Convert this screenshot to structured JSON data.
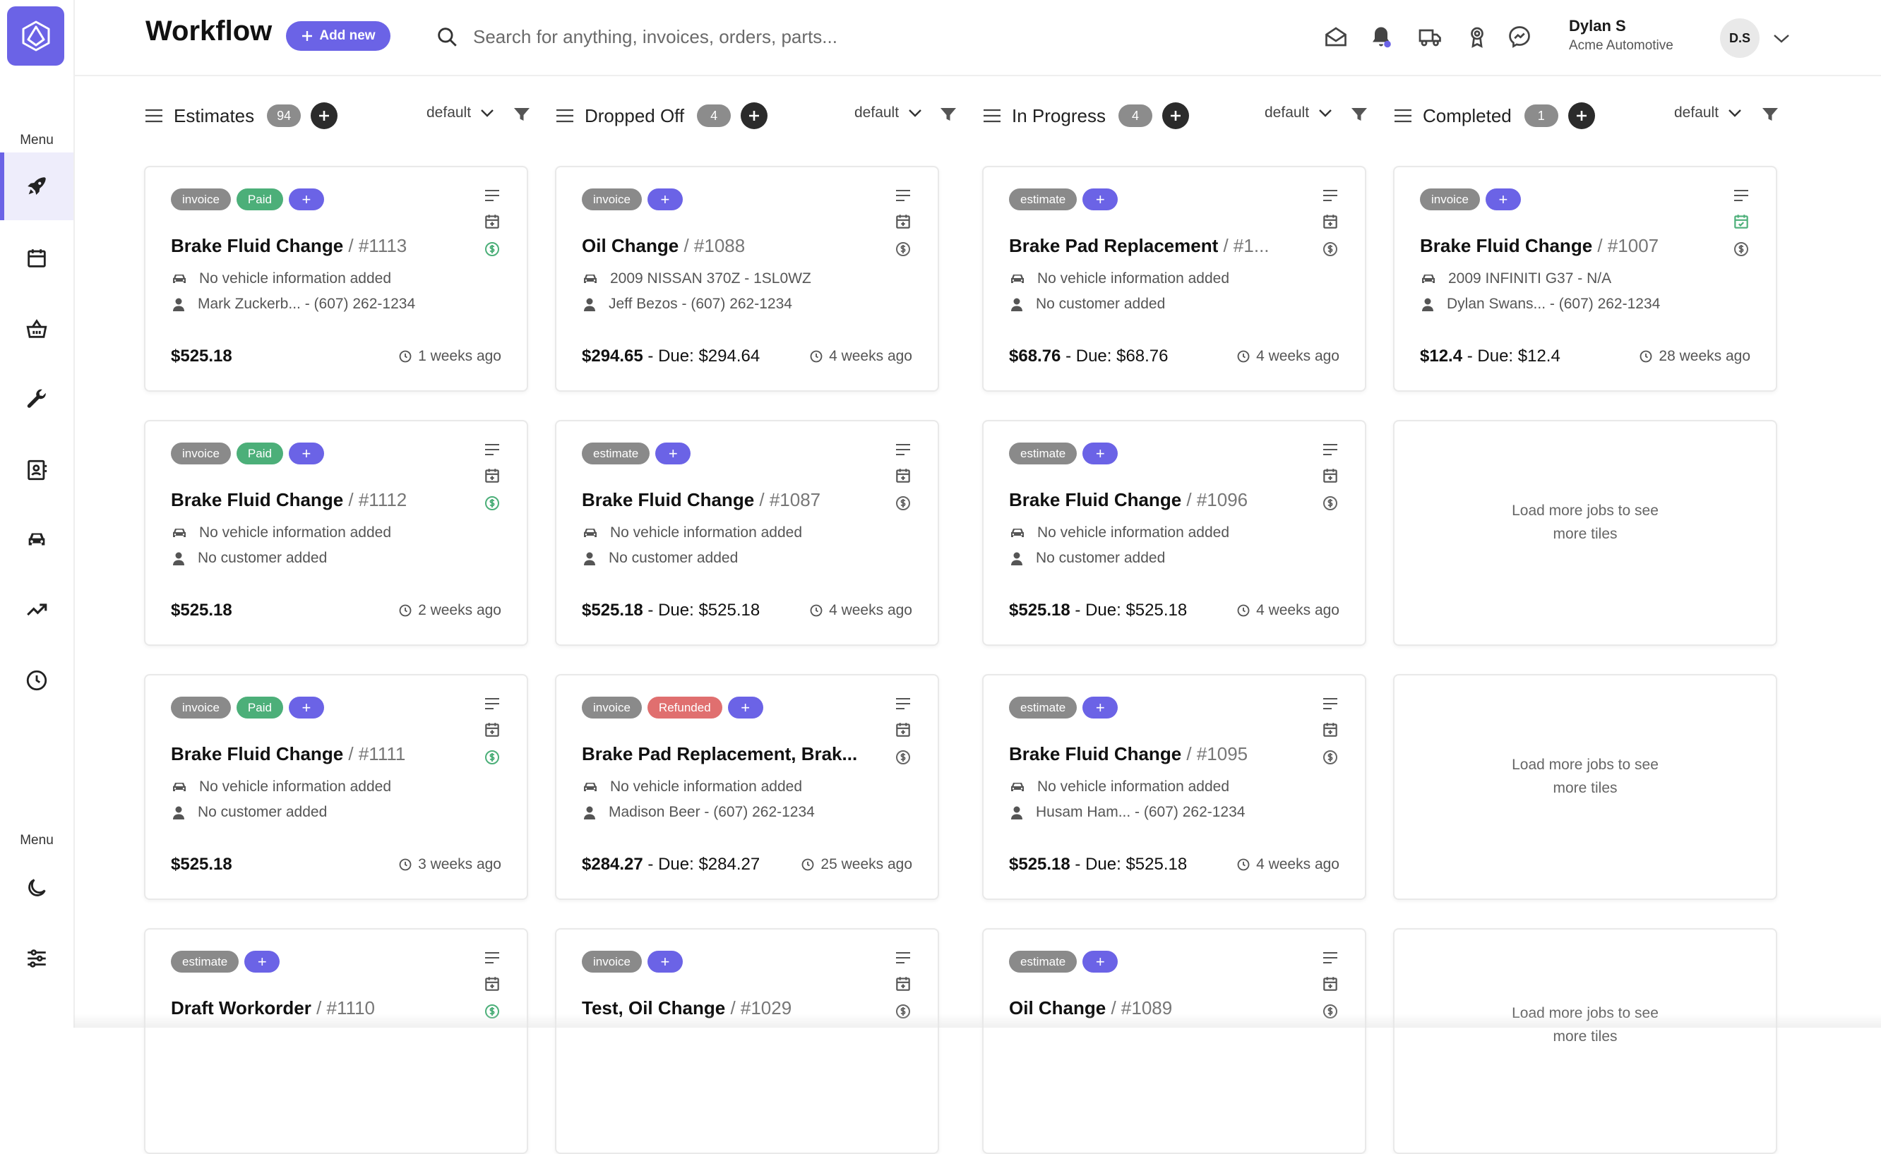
{
  "app": {
    "title": "Workflow",
    "add_new_label": "Add new",
    "search_placeholder": "Search for anything, invoices, orders, parts...",
    "user": {
      "name": "Dylan S",
      "company": "Acme Automotive",
      "initials": "D.S"
    }
  },
  "sidebar": {
    "menu_label_top": "Menu",
    "menu_label_bottom": "Menu",
    "items": [
      "rocket",
      "calendar",
      "basket",
      "wrench",
      "contacts",
      "car",
      "trending",
      "clock"
    ],
    "bottom_items": [
      "moon",
      "settings"
    ]
  },
  "colors": {
    "accent": "#6b63e6",
    "paid": "#4caf79",
    "refunded": "#e06f6f",
    "tag_gray": "#8a8a8a"
  },
  "columns": [
    {
      "title": "Estimates",
      "count": "94",
      "sort": "default"
    },
    {
      "title": "Dropped Off",
      "count": "4",
      "sort": "default"
    },
    {
      "title": "In Progress",
      "count": "4",
      "sort": "default"
    },
    {
      "title": "Completed",
      "count": "1",
      "sort": "default"
    }
  ],
  "cards": {
    "c0": [
      {
        "tags": [
          "invoice",
          "Paid"
        ],
        "title": "Brake Fluid Change",
        "number": "#1113",
        "vehicle": "No vehicle information added",
        "customer": "Mark Zuckerb...  - (607) 262-1234",
        "amount": "$525.18",
        "due": "",
        "ago": "1 weeks ago"
      },
      {
        "tags": [
          "invoice",
          "Paid"
        ],
        "title": "Brake Fluid Change",
        "number": "#1112",
        "vehicle": "No vehicle information added",
        "customer": "No customer added",
        "amount": "$525.18",
        "due": "",
        "ago": "2 weeks ago"
      },
      {
        "tags": [
          "invoice",
          "Paid"
        ],
        "title": "Brake Fluid Change",
        "number": "#1111",
        "vehicle": "No vehicle information added",
        "customer": "No customer added",
        "amount": "$525.18",
        "due": "",
        "ago": "3 weeks ago"
      },
      {
        "tags": [
          "estimate"
        ],
        "title": "Draft Workorder",
        "number": "#1110"
      }
    ],
    "c1": [
      {
        "tags": [
          "invoice"
        ],
        "title": "Oil Change",
        "number": "#1088",
        "vehicle": "2009 NISSAN 370Z  - 1SL0WZ",
        "customer": "Jeff Bezos  - (607) 262-1234",
        "amount": "$294.65",
        "due": " - Due: $294.64",
        "ago": "4 weeks ago"
      },
      {
        "tags": [
          "estimate"
        ],
        "title": "Brake Fluid Change",
        "number": "#1087",
        "vehicle": "No vehicle information added",
        "customer": "No customer added",
        "amount": "$525.18",
        "due": " - Due: $525.18",
        "ago": "4 weeks ago"
      },
      {
        "tags": [
          "invoice",
          "Refunded"
        ],
        "title": "Brake Pad Replacement, Brak...",
        "number": "",
        "vehicle": "No vehicle information added",
        "customer": "Madison Beer  - (607) 262-1234",
        "amount": "$284.27",
        "due": " - Due: $284.27",
        "ago": "25 weeks ago"
      },
      {
        "tags": [
          "invoice"
        ],
        "title": "Test, Oil Change",
        "number": "#1029"
      }
    ],
    "c2": [
      {
        "tags": [
          "estimate"
        ],
        "title": "Brake Pad Replacement",
        "number": "#1...",
        "vehicle": "No vehicle information added",
        "customer": "No customer added",
        "amount": "$68.76",
        "due": " - Due: $68.76",
        "ago": "4 weeks ago"
      },
      {
        "tags": [
          "estimate"
        ],
        "title": "Brake Fluid Change",
        "number": "#1096",
        "vehicle": "No vehicle information added",
        "customer": "No customer added",
        "amount": "$525.18",
        "due": " - Due: $525.18",
        "ago": "4 weeks ago"
      },
      {
        "tags": [
          "estimate"
        ],
        "title": "Brake Fluid Change",
        "number": "#1095",
        "vehicle": "No vehicle information added",
        "customer": "Husam Ham...    - (607) 262-1234",
        "amount": "$525.18",
        "due": " - Due: $525.18",
        "ago": "4 weeks ago"
      },
      {
        "tags": [
          "estimate"
        ],
        "title": "Oil Change",
        "number": "#1089"
      }
    ],
    "c3": [
      {
        "tags": [
          "invoice"
        ],
        "title": "Brake Fluid Change",
        "number": "#1007",
        "vehicle": "2009 INFINITI G37  - N/A",
        "customer": "Dylan Swans...    - (607) 262-1234",
        "amount": "$12.4",
        "due": " - Due: $12.4",
        "ago": "28 weeks ago"
      }
    ]
  },
  "load_more_line1": "Load more jobs to see",
  "load_more_line2": "more tiles"
}
